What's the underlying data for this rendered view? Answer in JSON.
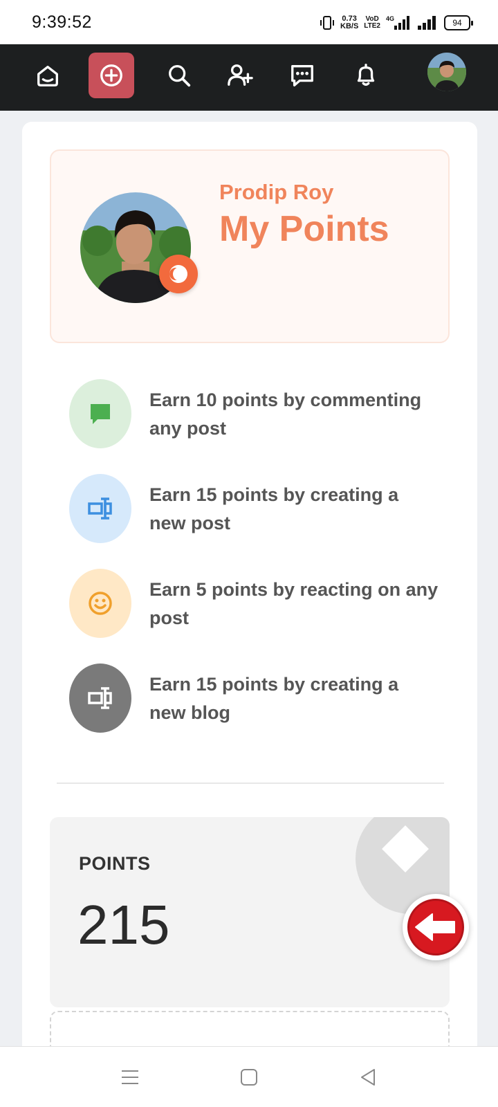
{
  "status_bar": {
    "time": "9:39:52",
    "net_speed_value": "0.73",
    "net_speed_unit": "KB/S",
    "volte_top": "VoD",
    "volte_bottom": "LTE2",
    "network": "4G",
    "battery": "94"
  },
  "top_nav": {
    "items": [
      {
        "name": "home-icon"
      },
      {
        "name": "create-post-icon",
        "active": true
      },
      {
        "name": "search-icon"
      },
      {
        "name": "add-friend-icon"
      },
      {
        "name": "messages-icon"
      },
      {
        "name": "notifications-icon"
      },
      {
        "name": "profile-avatar"
      }
    ],
    "bar_color": "#1d1f20",
    "active_color": "#c8505a"
  },
  "hero": {
    "user_name": "Prodip Roy",
    "title": "My Points",
    "accent_color": "#f0845b"
  },
  "earn_rules": [
    {
      "text": "Earn 10 points by commenting any post",
      "icon": "comment-icon",
      "bg": "#dcefdc",
      "fg": "#4caf50"
    },
    {
      "text": "Earn 15 points by creating a new post",
      "icon": "post-icon",
      "bg": "#d6e9fb",
      "fg": "#3d8fe0"
    },
    {
      "text": "Earn 5 points by reacting on any post",
      "icon": "smiley-icon",
      "bg": "#ffe8c6",
      "fg": "#f0a02c"
    },
    {
      "text": "Earn 15 points by creating a new blog",
      "icon": "blog-icon",
      "bg": "#7a7a7a",
      "fg": "#ffffff"
    }
  ],
  "points": {
    "label": "POINTS",
    "value": "215"
  },
  "system_nav": {
    "items": [
      "menu-icon",
      "home-square-icon",
      "back-triangle-icon"
    ]
  }
}
